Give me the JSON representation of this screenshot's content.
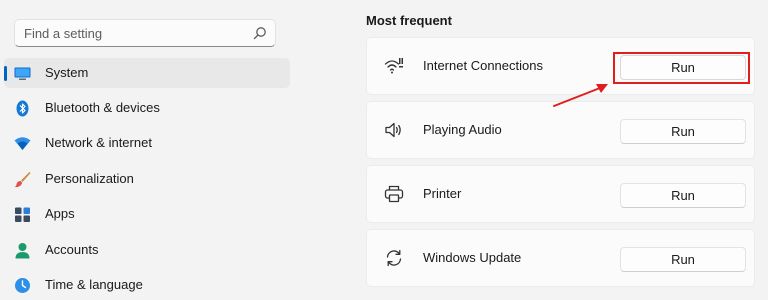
{
  "search": {
    "placeholder": "Find a setting",
    "icon": "search-icon"
  },
  "sidebar": {
    "items": [
      {
        "label": "System",
        "icon": "monitor-icon",
        "active": true
      },
      {
        "label": "Bluetooth & devices",
        "icon": "bluetooth-icon"
      },
      {
        "label": "Network & internet",
        "icon": "wifi-icon"
      },
      {
        "label": "Personalization",
        "icon": "paintbrush-icon"
      },
      {
        "label": "Apps",
        "icon": "apps-grid-icon"
      },
      {
        "label": "Accounts",
        "icon": "person-icon"
      },
      {
        "label": "Time & language",
        "icon": "globe-clock-icon"
      }
    ]
  },
  "main": {
    "section_title": "Most frequent",
    "troubleshooters": [
      {
        "label": "Internet Connections",
        "icon": "wifi-signal-icon",
        "button": "Run"
      },
      {
        "label": "Playing Audio",
        "icon": "speaker-icon",
        "button": "Run"
      },
      {
        "label": "Printer",
        "icon": "printer-icon",
        "button": "Run"
      },
      {
        "label": "Windows Update",
        "icon": "sync-icon",
        "button": "Run"
      }
    ]
  },
  "annotation": {
    "color": "#e01e1e"
  },
  "colors": {
    "accent": "#0067c0",
    "background": "#f3f3f3",
    "card": "#fbfbfb"
  }
}
